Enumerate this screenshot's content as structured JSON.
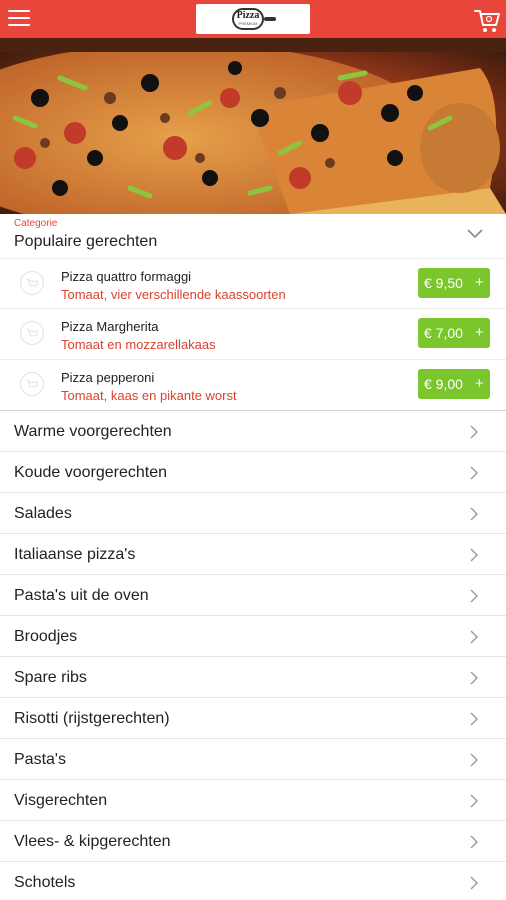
{
  "header": {
    "logo_text": "Pizza",
    "logo_subtext": "PREMIUM",
    "icons": {
      "menu": "hamburger-icon",
      "cart": "cart-icon"
    },
    "colors": {
      "bar": "#e8463a",
      "price": "#7bc62d",
      "desc": "#d8432f"
    }
  },
  "category": {
    "caption": "Categorie",
    "title": "Populaire gerechten",
    "dishes": [
      {
        "name": "Pizza quattro formaggi",
        "desc": "Tomaat, vier verschillende kaassoorten",
        "price": "€ 9,50",
        "plus": "+"
      },
      {
        "name": "Pizza Margherita",
        "desc": "Tomaat en mozzarellakaas",
        "price": "€ 7,00",
        "plus": "+"
      },
      {
        "name": "Pizza pepperoni",
        "desc": "Tomaat, kaas en pikante worst",
        "price": "€ 9,00",
        "plus": "+"
      }
    ]
  },
  "menu": [
    "Warme voorgerechten",
    "Koude voorgerechten",
    "Salades",
    "Italiaanse pizza's",
    "Pasta's uit de oven",
    "Broodjes",
    "Spare ribs",
    "Risotti (rijstgerechten)",
    "Pasta's",
    "Visgerechten",
    "Vlees- & kipgerechten",
    "Schotels"
  ]
}
